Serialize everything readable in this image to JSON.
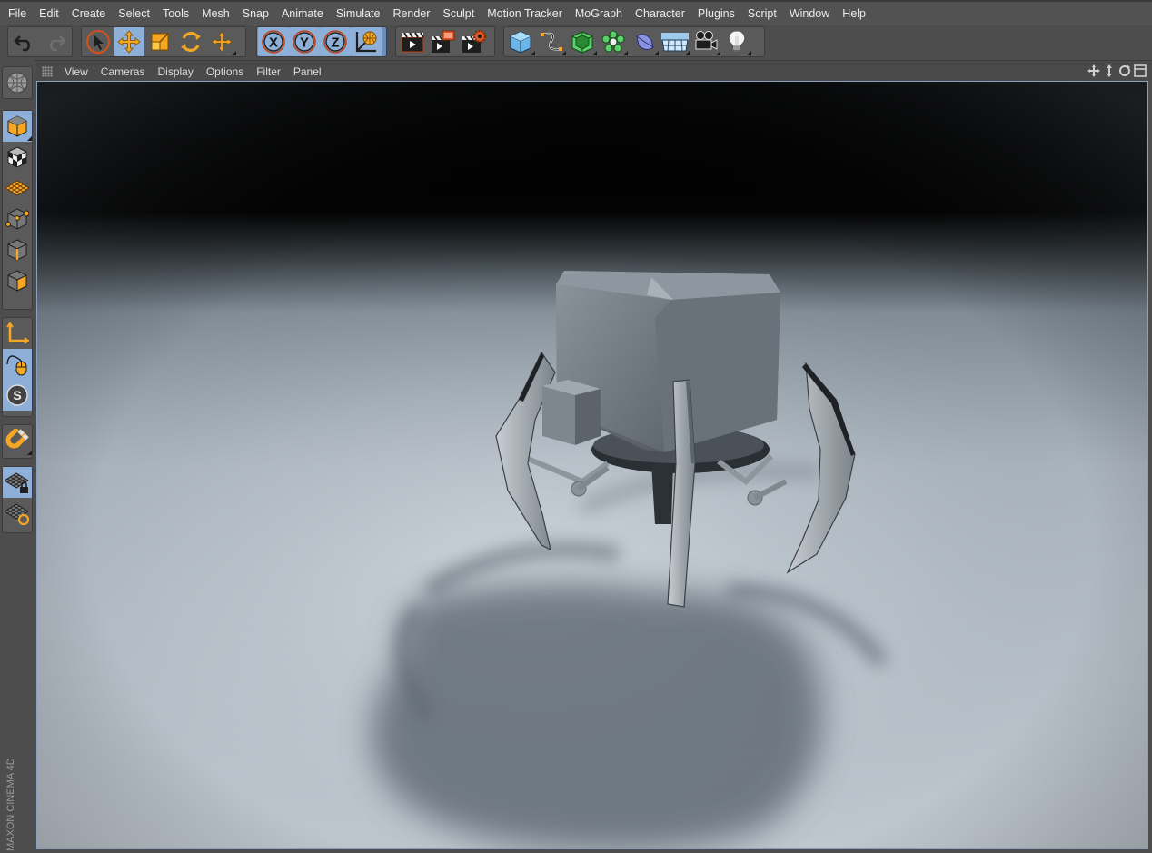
{
  "menubar": {
    "items": [
      "File",
      "Edit",
      "Create",
      "Select",
      "Tools",
      "Mesh",
      "Snap",
      "Animate",
      "Simulate",
      "Render",
      "Sculpt",
      "Motion Tracker",
      "MoGraph",
      "Character",
      "Plugins",
      "Script",
      "Window",
      "Help"
    ]
  },
  "viewport": {
    "menu": [
      "View",
      "Cameras",
      "Display",
      "Options",
      "Filter",
      "Panel"
    ]
  },
  "branding": {
    "vertical_logo": "MAXON CINEMA 4D"
  },
  "colors": {
    "accent_orange": "#f5a623",
    "active_blue": "#8eafd8",
    "sky_black": "#000000",
    "floor": "#c9d0d6"
  }
}
